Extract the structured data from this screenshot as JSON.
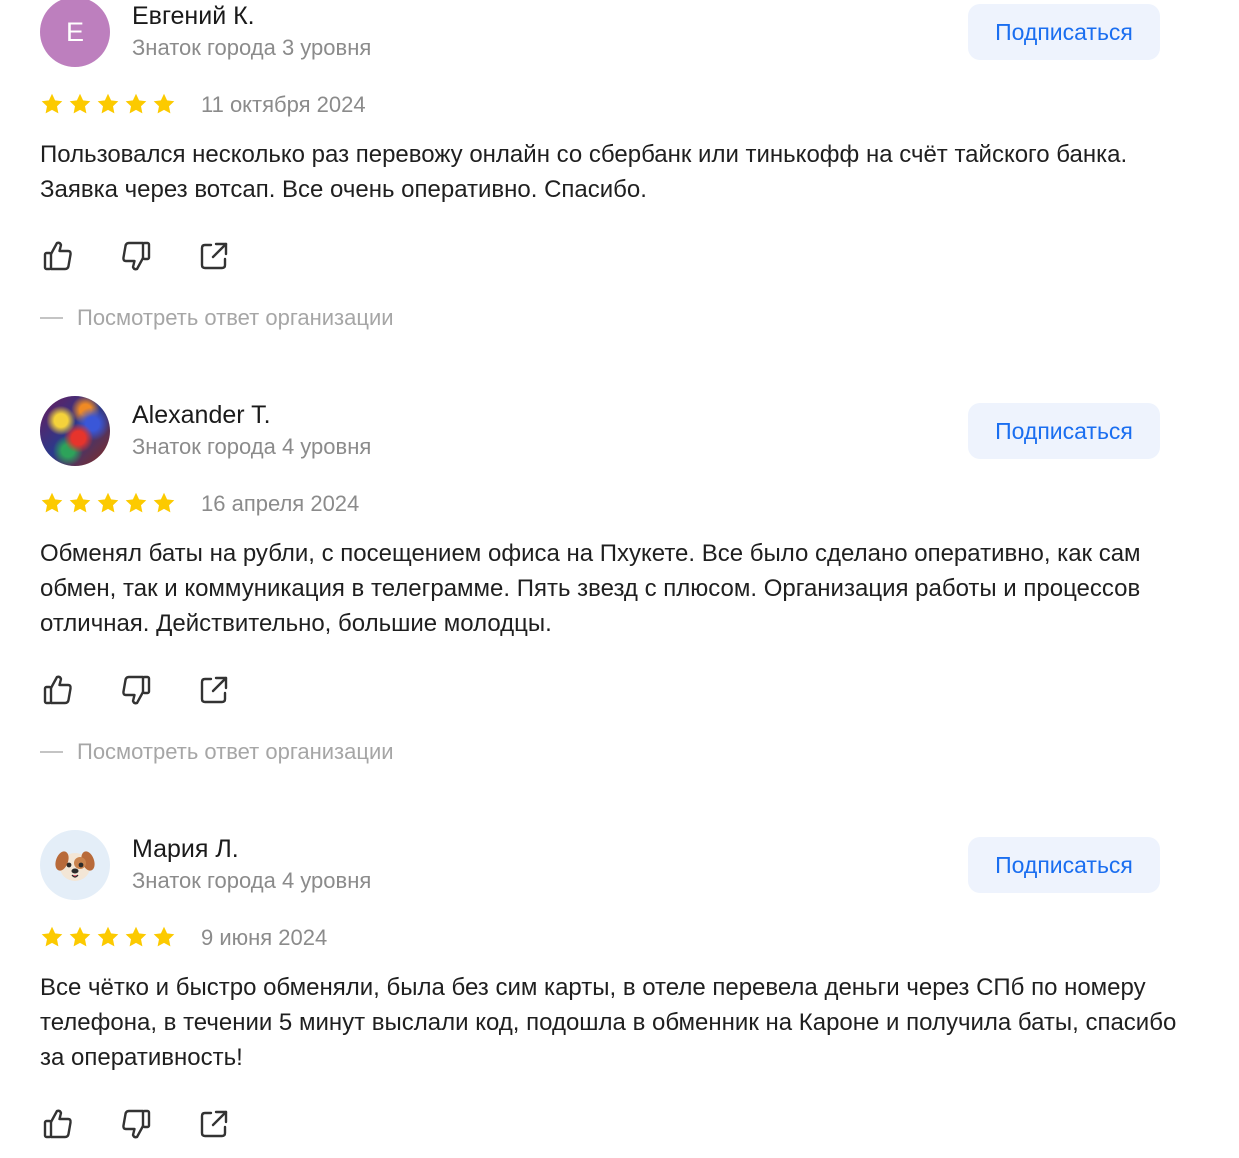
{
  "reviews": [
    {
      "avatar_letter": "Е",
      "name": "Евгений К.",
      "level": "Знаток города 3 уровня",
      "subscribe_label": "Подписаться",
      "rating": 5,
      "date": "11 октября 2024",
      "text": "Пользовался несколько раз перевожу онлайн со сбербанк или тинькофф на счёт тайского банка. Заявка через вотсап. Все очень оперативно. Спасибо.",
      "org_answer_label": "Посмотреть ответ организации"
    },
    {
      "name": "Alexander T.",
      "level": "Знаток города 4 уровня",
      "subscribe_label": "Подписаться",
      "rating": 5,
      "date": "16 апреля 2024",
      "text": "Обменял баты на рубли, с посещением офиса на Пхукете. Все было сделано оперативно, как сам обмен, так и коммуникация в телеграмме. Пять звезд с плюсом. Организация работы и процессов отличная. Действительно, большие молодцы.",
      "org_answer_label": "Посмотреть ответ организации"
    },
    {
      "name": "Мария Л.",
      "level": "Знаток города 4 уровня",
      "subscribe_label": "Подписаться",
      "rating": 5,
      "date": "9 июня 2024",
      "text": "Все чётко и быстро обменяли, была без сим карты, в отеле перевела деньги через СПб по номеру телефона, в течении 5 минут выслали код, подошла в обменник на Кароне и получила баты, спасибо за оперативность!"
    }
  ],
  "icons": {
    "star": "star-icon",
    "like": "thumbs-up-icon",
    "dislike": "thumbs-down-icon",
    "share": "share-icon"
  },
  "colors": {
    "star": "#fcca00",
    "subscribe_text": "#1a6ef0",
    "subscribe_bg": "#eef3fd",
    "muted_text": "#8b8b8b",
    "avatar_letter_bg": "#bd7fbe"
  }
}
